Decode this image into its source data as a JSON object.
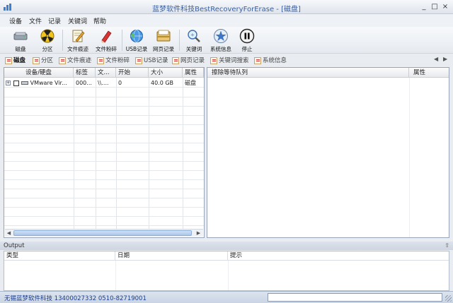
{
  "window": {
    "title": "蓝梦软件科技BestRecoveryForErase - [磁盘]",
    "controls": [
      "_",
      "□",
      "×"
    ]
  },
  "menu": [
    "设备",
    "文件",
    "记录",
    "关键词",
    "帮助"
  ],
  "toolbar": {
    "buttons": [
      {
        "label": "磁盘",
        "icon": "disk-drive-icon"
      },
      {
        "label": "分区",
        "icon": "partition-radiation-icon"
      },
      {
        "label": "文件痕迹",
        "icon": "file-trace-icon"
      },
      {
        "label": "文件粉碎",
        "icon": "file-shred-icon"
      },
      {
        "label": "USB记录",
        "icon": "usb-globe-icon"
      },
      {
        "label": "网页记录",
        "icon": "web-record-icon"
      },
      {
        "label": "关键词",
        "icon": "magnifier-icon"
      },
      {
        "label": "系统信息",
        "icon": "star-badge-icon"
      },
      {
        "label": "停止",
        "icon": "pause-icon"
      }
    ]
  },
  "tabs": [
    "磁盘",
    "分区",
    "文件痕迹",
    "文件粉碎",
    "USB记录",
    "网页记录",
    "关键词搜索",
    "系统信息"
  ],
  "tab_nav": {
    "prev": "◀",
    "next": "▶"
  },
  "device_grid": {
    "columns": [
      "设备/硬盘",
      "标签",
      "文...",
      "开始",
      "大小",
      "属性"
    ],
    "rows": [
      {
        "device": "VMware Vir...",
        "label": "000...",
        "file": "\\\\....",
        "start": "0",
        "size": "40.0 GB",
        "attr": "磁盘"
      }
    ]
  },
  "erase_queue": {
    "columns": [
      "擦除等待队列",
      "属性"
    ]
  },
  "output": {
    "title": "Output",
    "pin": "⇧",
    "columns": [
      "类型",
      "日期",
      "提示"
    ]
  },
  "status": {
    "company": "无锡蓝梦软件科技 13400027332  0510-82719001"
  },
  "colors": {
    "accent": "#3a5f9e",
    "status_text": "#1a3d8c",
    "panel_border": "#98a4b6"
  }
}
